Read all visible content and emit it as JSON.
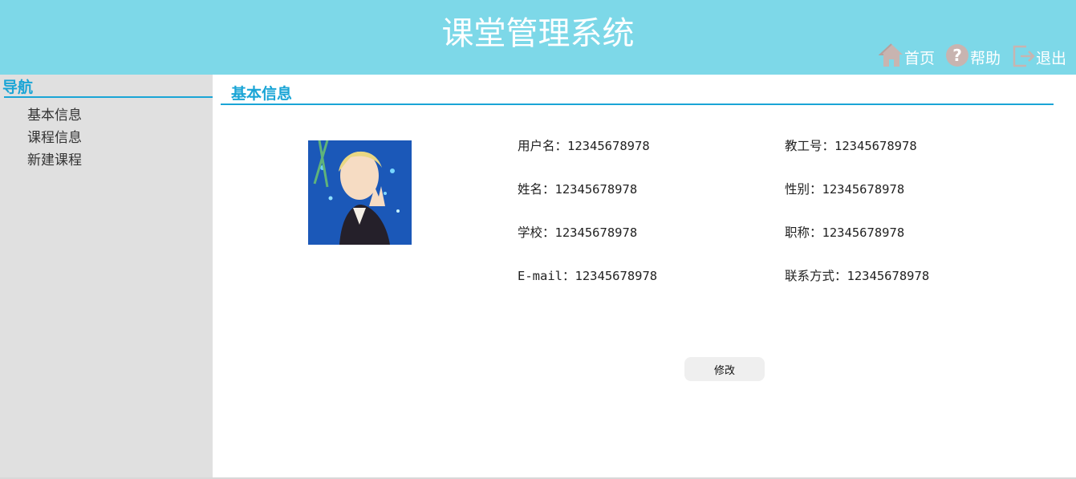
{
  "header": {
    "title": "课堂管理系统",
    "nav": [
      {
        "icon": "home-icon",
        "label": "首页"
      },
      {
        "icon": "help-icon",
        "label": "帮助"
      },
      {
        "icon": "logout-icon",
        "label": "退出"
      }
    ],
    "background_color": "#7dd8e8"
  },
  "sidebar": {
    "title": "导航",
    "items": [
      {
        "label": "基本信息"
      },
      {
        "label": "课程信息"
      },
      {
        "label": "新建课程"
      }
    ],
    "accent_color": "#1aa5d6"
  },
  "main": {
    "section_title": "基本信息",
    "fields": {
      "username": "用户名：12345678978",
      "staff_id": "教工号：12345678978",
      "name": "姓名：12345678978",
      "gender": "性别：12345678978",
      "school": "学校：12345678978",
      "title": "职称：12345678978",
      "email": "E-mail：12345678978",
      "contact": "联系方式：12345678978"
    },
    "edit_button": "修改"
  }
}
